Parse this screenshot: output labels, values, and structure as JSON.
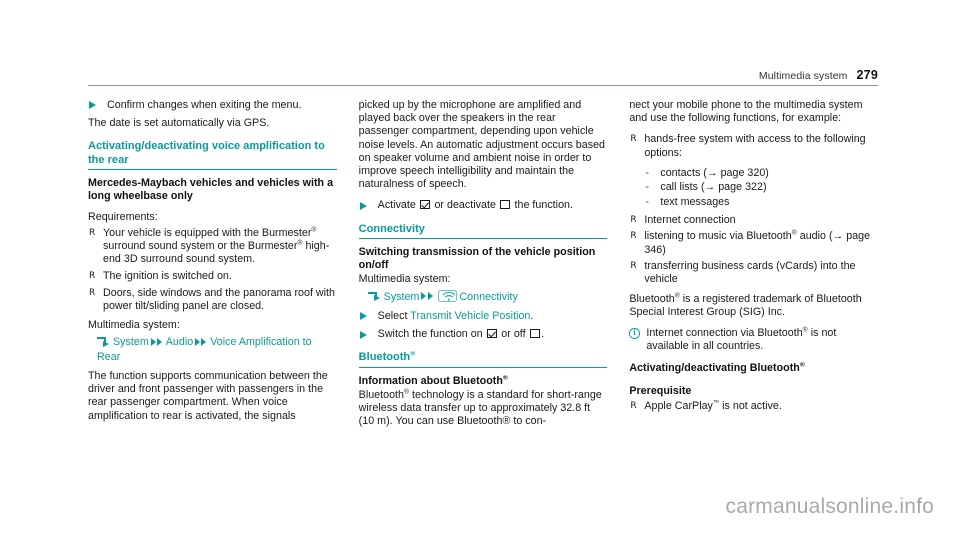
{
  "header": {
    "title": "Multimedia system",
    "page_number": "279"
  },
  "colors": {
    "accent_teal": "#0a9a9a",
    "text": "#1a1a1a",
    "rule_gray": "#8e9396",
    "watermark_gray": "#a9a9a9"
  },
  "column1": {
    "step_confirm": "Confirm changes when exiting the menu.",
    "para_date": "The date is set automatically via GPS.",
    "heading": "Activating/deactivating voice amplification to the rear",
    "subheading": "Mercedes-Maybach vehicles and vehicles with a long wheelbase only",
    "requirements_label": "Requirements:",
    "requirements": [
      "Your vehicle is equipped with the Burmester® surround sound system or the Burmester® high-end 3D surround sound system.",
      "The ignition is switched on.",
      "Doors, side windows and the panorama roof with power tilt/sliding panel are closed."
    ],
    "multimedia_label": "Multimedia system:",
    "menu_path": {
      "item1": "System",
      "item2": "Audio",
      "item3": "Voice Amplification to Rear"
    },
    "para_function": "The function supports communication between the driver and front passenger with passengers in the rear passenger compartment. When voice amplification to rear is activated, the signals"
  },
  "column2": {
    "para_continued": "picked up by the microphone are amplified and played back over the speakers in the rear passenger compartment, depending upon vehicle noise levels. An automatic adjustment occurs based on speaker volume and ambient noise in order to improve speech intelligibility and maintain the naturalness of speech.",
    "step_activate_prefix": "Activate",
    "step_activate_middle": "or deactivate",
    "step_activate_suffix": "the function.",
    "connectivity_heading": "Connectivity",
    "connectivity_subheading": "Switching transmission of the vehicle position on/off",
    "multimedia_label": "Multimedia system:",
    "menu_path": {
      "item1": "System",
      "item2": "Connectivity"
    },
    "step_select_prefix": "Select",
    "step_select_link": "Transmit Vehicle Position",
    "step_select_suffix": ".",
    "step_switch_prefix": "Switch the function on",
    "step_switch_middle": "or off",
    "step_switch_suffix": ".",
    "bluetooth_heading": "Bluetooth",
    "bluetooth_info_subheading": "Information about Bluetooth",
    "bluetooth_para": "technology is a standard for short-range wireless data transfer up to approximately 32.8 ft (10 m). You can use Bluetooth® to con-",
    "bluetooth_para_lead": "Bluetooth"
  },
  "column3": {
    "para_continued": "nect your mobile phone to the multimedia system and use the following functions, for example:",
    "bullet_handsfree": "hands-free system with access to the following options:",
    "subitems": [
      "contacts (→ page 320)",
      "call lists (→ page 322)",
      "text messages"
    ],
    "bullet_internet": "Internet connection",
    "bullet_music": "listening to music via Bluetooth® audio (→ page 346)",
    "bullet_vcards": "transferring business cards (vCards) into the vehicle",
    "trademark_para_lead": "Bluetooth",
    "trademark_para": "is a registered trademark of Bluetooth Special Interest Group (SIG) Inc.",
    "note_lead": "Internet connection via Bluetooth",
    "note_rest": "is not available in all countries.",
    "activating_heading": "Activating/deactivating Bluetooth",
    "prerequisite_heading": "Prerequisite",
    "prerequisite_item": "Apple CarPlay™ is not active."
  },
  "watermark": "carmanualsonline.info"
}
